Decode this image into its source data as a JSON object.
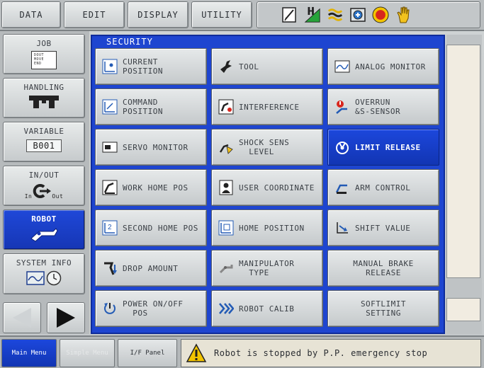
{
  "top_menu": {
    "data": "DATA",
    "edit": "EDIT",
    "display": "DISPLAY",
    "utility": "UTILITY"
  },
  "status_icons": [
    "edit-mode-icon",
    "signal-level-icon",
    "cycle-mode-icon",
    "servo-status-icon",
    "emergency-stop-icon",
    "hand-icon"
  ],
  "left_nav": {
    "job": {
      "label": "JOB",
      "icon_text": "DOUT\nMOVE\nEND"
    },
    "handling": {
      "label": "HANDLING"
    },
    "variable": {
      "label": "VARIABLE",
      "value": "B001"
    },
    "inout": {
      "label": "IN/OUT",
      "in": "In",
      "out": "Out"
    },
    "robot": {
      "label": "ROBOT"
    },
    "system_info": {
      "label": "SYSTEM INFO"
    }
  },
  "panel": {
    "title": "SECURITY",
    "buttons": [
      {
        "label": "CURRENT\nPOSITION",
        "icon": "current-position-icon"
      },
      {
        "label": "TOOL",
        "icon": "tool-icon"
      },
      {
        "label": "ANALOG MONITOR",
        "icon": "analog-monitor-icon"
      },
      {
        "label": "COMMAND\nPOSITION",
        "icon": "command-position-icon"
      },
      {
        "label": "INTERFERENCE",
        "icon": "interference-icon"
      },
      {
        "label": "OVERRUN\n&S-SENSOR",
        "icon": "overrun-sensor-icon"
      },
      {
        "label": "SERVO MONITOR",
        "icon": "servo-monitor-icon"
      },
      {
        "label": "SHOCK SENS\n  LEVEL",
        "icon": "shock-sens-icon"
      },
      {
        "label": "LIMIT RELEASE",
        "icon": "limit-release-icon"
      },
      {
        "label": "WORK HOME POS",
        "icon": "work-home-icon"
      },
      {
        "label": "USER COORDINATE",
        "icon": "user-coordinate-icon"
      },
      {
        "label": "ARM CONTROL",
        "icon": "arm-control-icon"
      },
      {
        "label": "SECOND HOME POS",
        "icon": "second-home-icon"
      },
      {
        "label": "HOME POSITION",
        "icon": "home-position-icon"
      },
      {
        "label": "SHIFT VALUE",
        "icon": "shift-value-icon"
      },
      {
        "label": "DROP AMOUNT",
        "icon": "drop-amount-icon"
      },
      {
        "label": "MANIPULATOR\n  TYPE",
        "icon": "manipulator-type-icon"
      },
      {
        "label": "MANUAL BRAKE\nRELEASE",
        "icon": ""
      },
      {
        "label": "POWER ON/OFF\n  POS",
        "icon": "power-on-off-icon"
      },
      {
        "label": "ROBOT CALIB",
        "icon": "robot-calib-icon"
      },
      {
        "label": "SOFTLIMIT\nSETTING",
        "icon": ""
      }
    ],
    "selected_index": 8
  },
  "bottom_bar": {
    "main_menu": "Main Menu",
    "simple_menu": "Simple Menu",
    "if_panel": "I/F Panel",
    "message": "Robot is stopped by P.P. emergency stop"
  },
  "colors": {
    "accent_blue": "#1e45d0",
    "button_gray": "#d3d6d8",
    "message_bg": "#e7e3d5"
  }
}
